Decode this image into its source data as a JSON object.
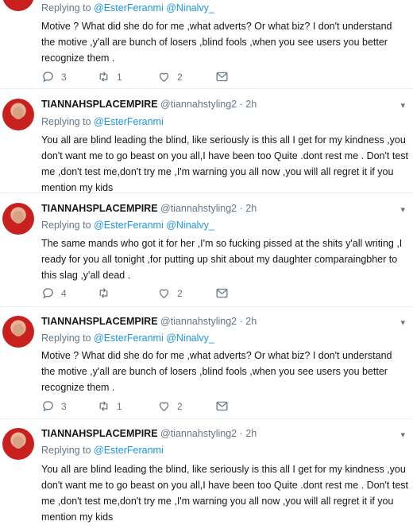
{
  "tweets": [
    {
      "replying_prefix": "Replying to",
      "replying_to": "@EsterFeranmi @Ninalvy_",
      "text": "Motive ? What did she do for me ,what adverts? Or what biz? I don't understand the motive ,y'all are bunch of losers ,blind fools ,when you see users you better recognize them .",
      "replies": "3",
      "retweets": "1",
      "likes": "2"
    },
    {
      "name": "TIANNAHSPLACEMPIRE",
      "handle": "@tiannahstyling2",
      "time": "· 2h",
      "replying_prefix": "Replying to",
      "replying_to": "@EsterFeranmi",
      "text": "You all are blind leading the blind, like seriously is this all I get for my kindness ,you don't want me to go beast on you all,I have been too Quite .dont rest me . Don't test me ,don't test me,don't try me ,I'm warning you all now ,you will all regret it if you mention my kids"
    },
    {
      "name": "TIANNAHSPLACEMPIRE",
      "handle": "@tiannahstyling2",
      "time": "· 2h",
      "replying_prefix": "Replying to",
      "replying_to": "@EsterFeranmi @Ninalvy_",
      "text": "The same mands who got it for her ,I'm so fucking pissed at the shits y'all writing ,I ready for you all tonight ,for putting up shit about my daughter comparaingbher to this slag ,y'all dead .",
      "replies": "4",
      "retweets": "",
      "likes": "2"
    },
    {
      "name": "TIANNAHSPLACEMPIRE",
      "handle": "@tiannahstyling2",
      "time": "· 2h",
      "replying_prefix": "Replying to",
      "replying_to": "@EsterFeranmi @Ninalvy_",
      "text": "Motive ? What did she do for me ,what adverts? Or what biz? I don't understand the motive ,y'all are bunch of losers ,blind fools ,when you see users you better recognize them .",
      "replies": "3",
      "retweets": "1",
      "likes": "2"
    },
    {
      "name": "TIANNAHSPLACEMPIRE",
      "handle": "@tiannahstyling2",
      "time": "· 2h",
      "replying_prefix": "Replying to",
      "replying_to": "@EsterFeranmi",
      "text": "You all are blind leading the blind, like seriously is this all I get for my kindness ,you don't want me to go beast on you all,I have been too Quite .dont rest me . Don't test me ,don't test me,don't try me ,I'm warning you all now ,you will all regret it if you mention my kids"
    }
  ],
  "icons": {
    "reply": "reply-icon",
    "retweet": "retweet-icon",
    "like": "heart-icon",
    "dm": "envelope-icon",
    "more": "chevron-down-icon",
    "avatar": "avatar"
  },
  "colors": {
    "link": "#1b95e0",
    "muted": "#657786",
    "text": "#14171a",
    "divider": "#e6ecf0",
    "avatar_red": "#c8201e"
  }
}
